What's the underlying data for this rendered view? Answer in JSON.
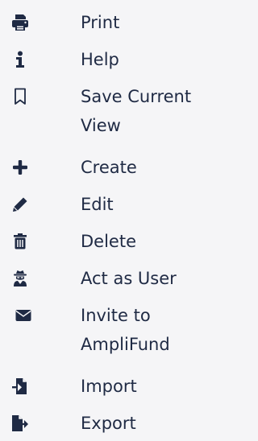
{
  "menu": {
    "items": [
      {
        "label": "Print",
        "icon": "print-icon"
      },
      {
        "label": "Help",
        "icon": "info-icon"
      },
      {
        "label": "Save Current View",
        "icon": "bookmark-icon"
      },
      {
        "label": "Create",
        "icon": "plus-icon"
      },
      {
        "label": "Edit",
        "icon": "pencil-icon"
      },
      {
        "label": "Delete",
        "icon": "trash-icon"
      },
      {
        "label": "Act as User",
        "icon": "user-secret-icon"
      },
      {
        "label": "Invite to AmpliFund",
        "icon": "envelope-icon"
      },
      {
        "label": "Import",
        "icon": "file-import-icon"
      },
      {
        "label": "Export",
        "icon": "file-export-icon"
      }
    ]
  },
  "colors": {
    "text": "#1f2a44",
    "icon": "#1f2a44",
    "background": "#f5f5f7"
  }
}
